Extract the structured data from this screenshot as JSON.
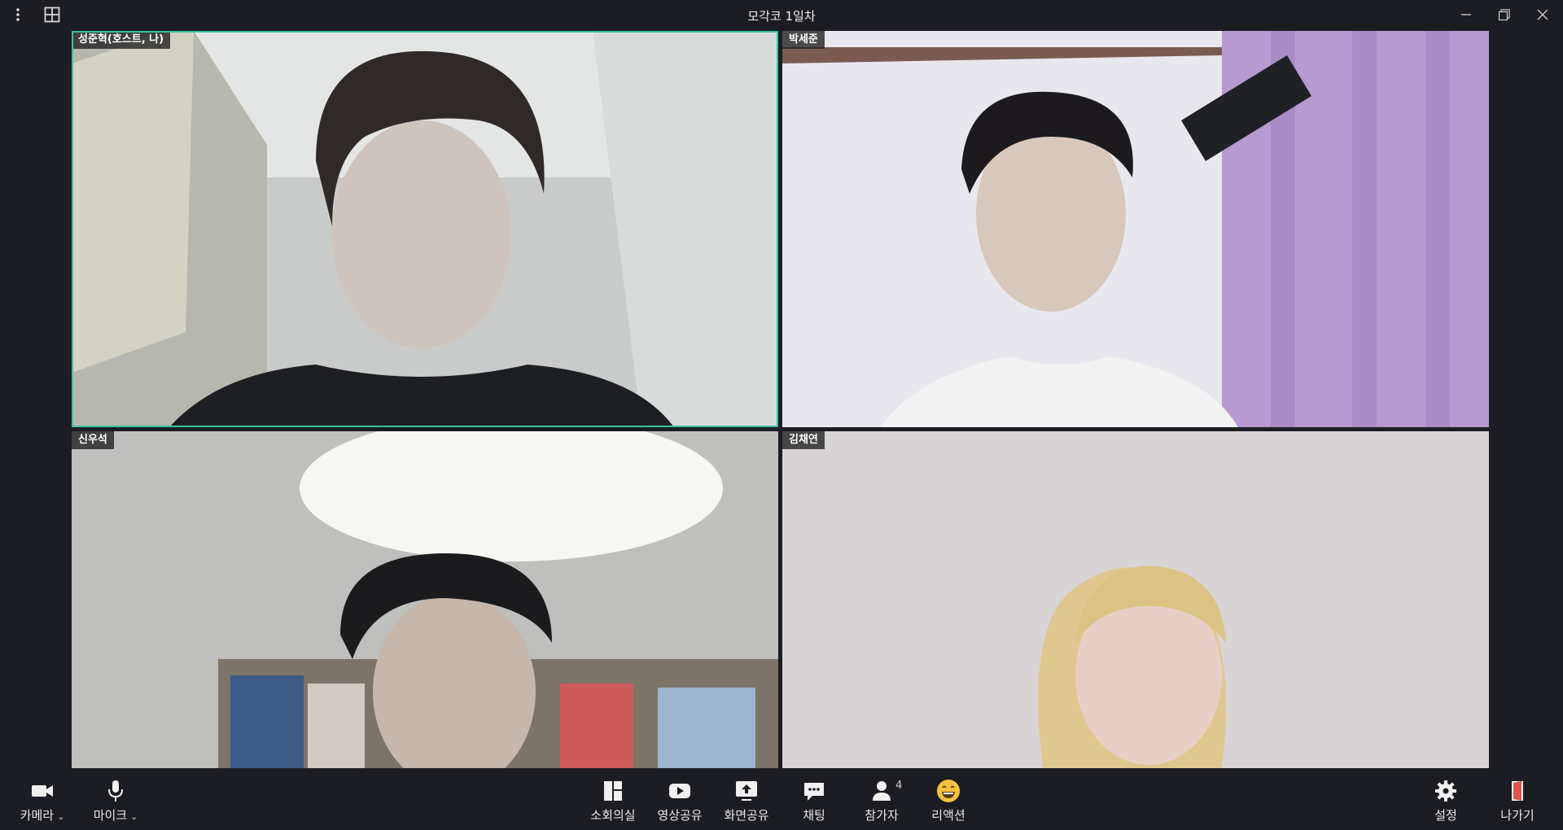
{
  "window": {
    "title": "모각코 1일차"
  },
  "participants": [
    {
      "name": "성준혁(호스트, 나)",
      "active": true
    },
    {
      "name": "박세준",
      "active": false
    },
    {
      "name": "신우석",
      "active": false
    },
    {
      "name": "김채연",
      "active": false
    }
  ],
  "toolbar": {
    "camera_label": "카메라",
    "mic_label": "마이크",
    "breakout_label": "소회의실",
    "video_share_label": "영상공유",
    "screen_share_label": "화면공유",
    "chat_label": "채팅",
    "participants_label": "참가자",
    "participants_count": "4",
    "reaction_label": "리액션",
    "settings_label": "설정",
    "leave_label": "나가기"
  },
  "colors": {
    "background": "#1b1d22",
    "active_speaker_border": "#3fbfa0",
    "leave_accent": "#e0524a"
  }
}
